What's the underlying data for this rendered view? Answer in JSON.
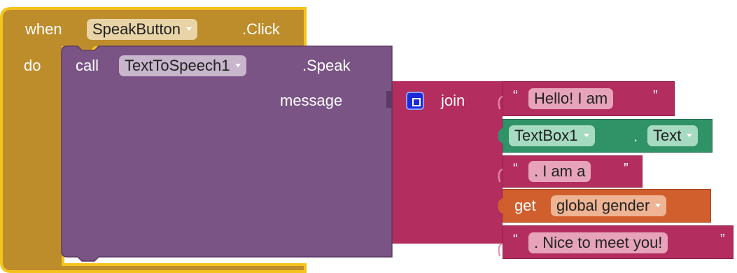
{
  "event_block": {
    "when": "when",
    "component": "SpeakButton",
    "event": ".Click",
    "do": "do",
    "color": "#bd8c2b",
    "border": "#f4c31e"
  },
  "call_block": {
    "call": "call",
    "component": "TextToSpeech1",
    "method": ".Speak",
    "param": "message",
    "color": "#7a5485"
  },
  "join_block": {
    "label": "join",
    "gear_icon": "mutator-gear-icon",
    "color": "#b32d5e"
  },
  "text1": {
    "open_quote": "“",
    "value": "Hello! I am",
    "close_quote": "”"
  },
  "textbox_block": {
    "component": "TextBox1",
    "dot": ".",
    "property": "Text",
    "color": "#2f9367"
  },
  "text2": {
    "open_quote": "“",
    "value": ". I am a",
    "close_quote": "”"
  },
  "get_block": {
    "label": "get",
    "variable": "global gender",
    "color": "#d05f2d"
  },
  "text3": {
    "open_quote": "“",
    "value": ". Nice to meet you!",
    "close_quote": "”"
  }
}
